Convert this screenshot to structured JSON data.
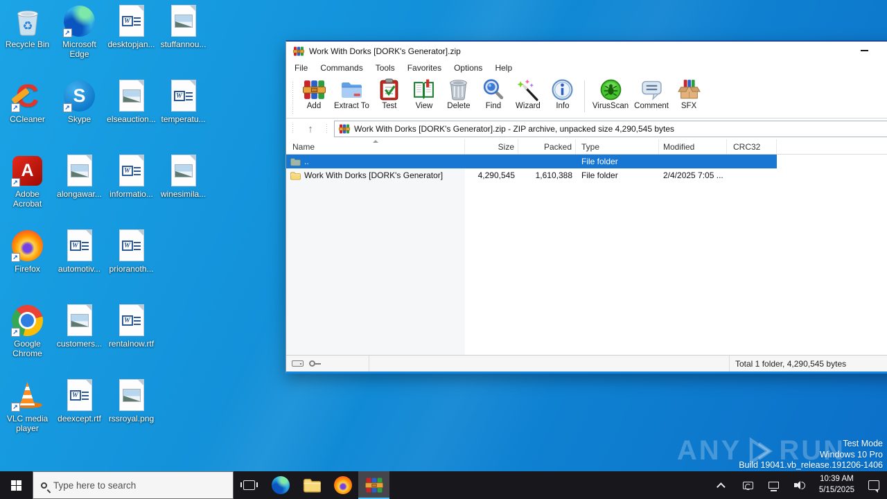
{
  "desktop": {
    "icons": [
      {
        "label": "Recycle Bin",
        "type": "recycle-bin"
      },
      {
        "label": "Microsoft Edge",
        "type": "edge"
      },
      {
        "label": "desktopjan...",
        "type": "word"
      },
      {
        "label": "stuffannou...",
        "type": "image"
      },
      {
        "label": "CCleaner",
        "type": "ccleaner"
      },
      {
        "label": "Skype",
        "type": "skype"
      },
      {
        "label": "elseauction...",
        "type": "image"
      },
      {
        "label": "temperatu...",
        "type": "word"
      },
      {
        "label": "Adobe Acrobat",
        "type": "acrobat"
      },
      {
        "label": "alongawar...",
        "type": "image"
      },
      {
        "label": "informatio...",
        "type": "word"
      },
      {
        "label": "winesimila...",
        "type": "image"
      },
      {
        "label": "Firefox",
        "type": "firefox"
      },
      {
        "label": "automotiv...",
        "type": "word"
      },
      {
        "label": "prioranoth...",
        "type": "word"
      },
      {
        "label": "Google Chrome",
        "type": "chrome"
      },
      {
        "label": "customers...",
        "type": "image"
      },
      {
        "label": "rentalnow.rtf",
        "type": "word"
      },
      {
        "label": "VLC media player",
        "type": "vlc"
      },
      {
        "label": "deexcept.rtf",
        "type": "word"
      },
      {
        "label": "rssroyal.png",
        "type": "image"
      }
    ]
  },
  "window": {
    "title": "Work With Dorks [DORK's Generator].zip",
    "menu": {
      "items": [
        {
          "label": "File"
        },
        {
          "label": "Commands"
        },
        {
          "label": "Tools"
        },
        {
          "label": "Favorites"
        },
        {
          "label": "Options"
        },
        {
          "label": "Help"
        }
      ]
    },
    "toolbar": {
      "buttons": [
        {
          "label": "Add"
        },
        {
          "label": "Extract To"
        },
        {
          "label": "Test"
        },
        {
          "label": "View"
        },
        {
          "label": "Delete"
        },
        {
          "label": "Find"
        },
        {
          "label": "Wizard"
        },
        {
          "label": "Info"
        },
        {
          "label": "VirusScan"
        },
        {
          "label": "Comment"
        },
        {
          "label": "SFX"
        }
      ]
    },
    "address": {
      "value": "Work With Dorks [DORK's Generator].zip - ZIP archive, unpacked size 4,290,545 bytes"
    },
    "list": {
      "columns": [
        {
          "label": "Name"
        },
        {
          "label": "Size"
        },
        {
          "label": "Packed"
        },
        {
          "label": "Type"
        },
        {
          "label": "Modified"
        },
        {
          "label": "CRC32"
        }
      ],
      "rows": [
        {
          "name": "..",
          "size": "",
          "packed": "",
          "type": "File folder",
          "modified": "",
          "crc32": "",
          "selected": true
        },
        {
          "name": "Work With Dorks [DORK's Generator]",
          "size": "4,290,545",
          "packed": "1,610,388",
          "type": "File folder",
          "modified": "2/4/2025 7:05 ...",
          "crc32": "",
          "selected": false
        }
      ]
    },
    "status": {
      "total": "Total 1 folder, 4,290,545 bytes"
    }
  },
  "watermark": {
    "brand_left": "ANY",
    "brand_right": "RUN",
    "mode": "Test Mode",
    "os": "Windows 10 Pro",
    "build": "Build 19041.vb_release.191206-1406"
  },
  "taskbar": {
    "search": {
      "placeholder": "Type here to search"
    },
    "clock": {
      "time": "10:39 AM",
      "date": "5/15/2025"
    }
  },
  "colors": {
    "selection": "#1877d2",
    "desktop_top": "#1ba4e6",
    "desktop_bottom": "#0b6fc8",
    "taskbar": "#17171c",
    "accent_underline": "#4cc2ff"
  }
}
